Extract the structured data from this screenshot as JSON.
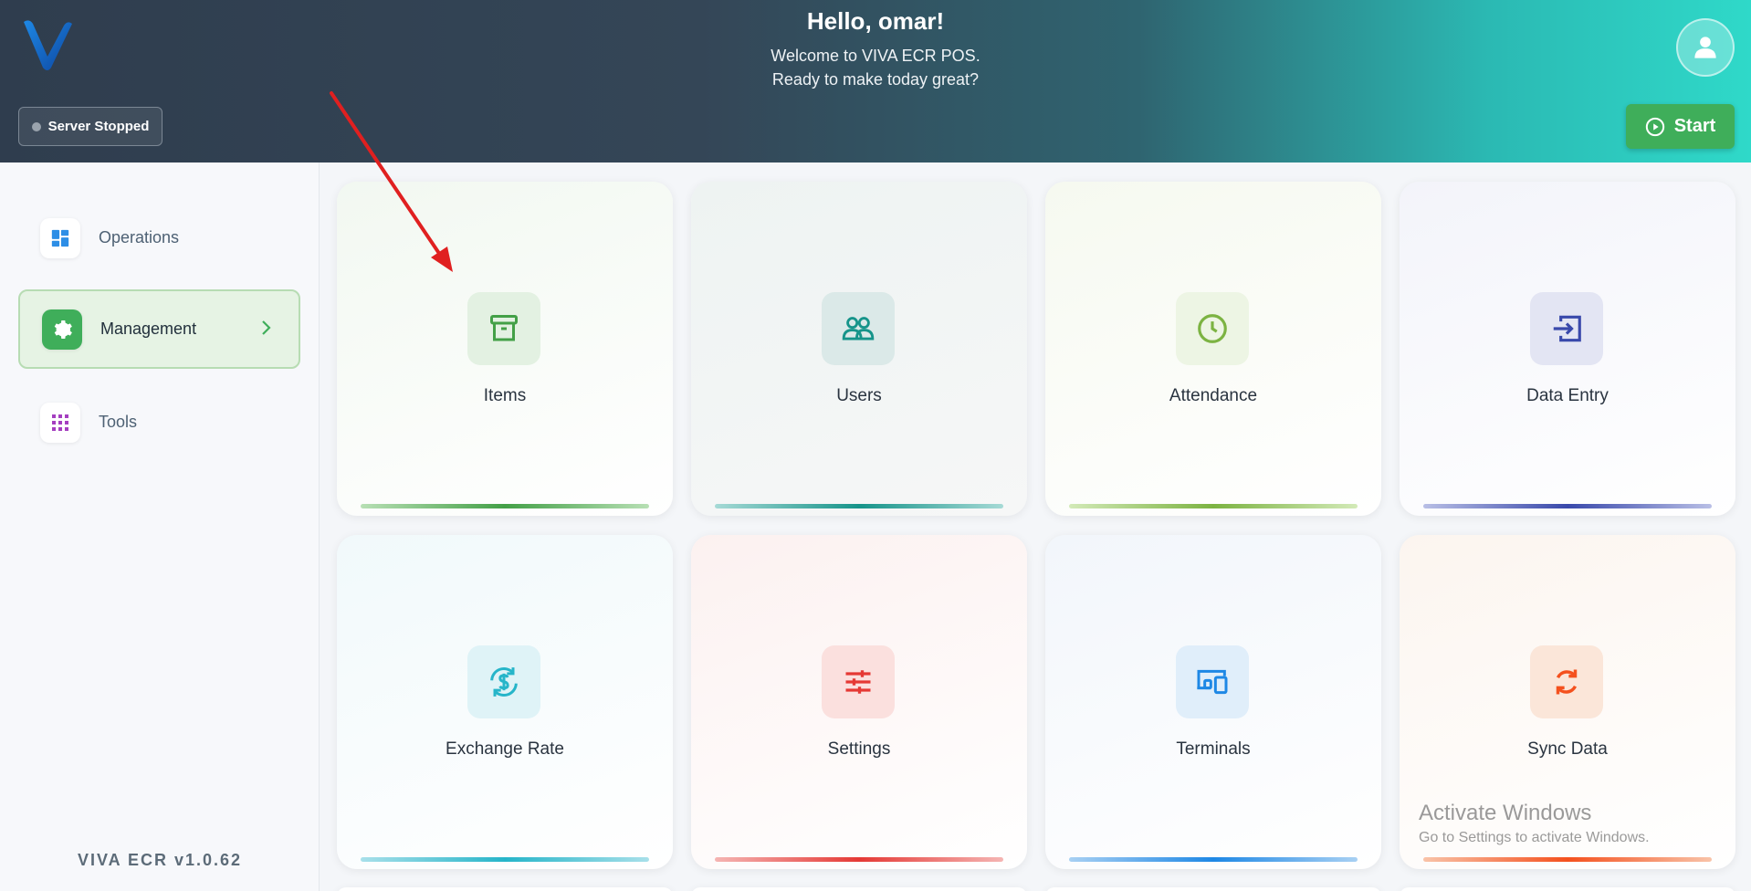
{
  "header": {
    "greeting": "Hello, omar!",
    "welcome": "Welcome to VIVA ECR POS.",
    "tagline": "Ready to make today great?",
    "server_status": "Server Stopped",
    "start_label": "Start"
  },
  "sidebar": {
    "items": [
      {
        "label": "Operations",
        "icon": "dashboard-icon",
        "active": false
      },
      {
        "label": "Management",
        "icon": "gear-icon",
        "active": true
      },
      {
        "label": "Tools",
        "icon": "grid-icon",
        "active": false
      }
    ],
    "version": "VIVA ECR  v1.0.62"
  },
  "cards": [
    {
      "label": "Items",
      "icon": "archive-box-icon",
      "color": "#43a047"
    },
    {
      "label": "Users",
      "icon": "users-icon",
      "color": "#16948a"
    },
    {
      "label": "Attendance",
      "icon": "clock-icon",
      "color": "#7cb342"
    },
    {
      "label": "Data Entry",
      "icon": "login-arrow-icon",
      "color": "#3949ab"
    },
    {
      "label": "Exchange Rate",
      "icon": "currency-exchange-icon",
      "color": "#26b5c9"
    },
    {
      "label": "Settings",
      "icon": "sliders-icon",
      "color": "#e53935"
    },
    {
      "label": "Terminals",
      "icon": "devices-icon",
      "color": "#1e88e5"
    },
    {
      "label": "Sync Data",
      "icon": "sync-icon",
      "color": "#f4511e"
    }
  ],
  "watermark": {
    "title": "Activate Windows",
    "subtitle": "Go to Settings to activate Windows."
  },
  "colors": {
    "accent_green": "#3fae5a",
    "header_dark": "#2f3d4e",
    "header_teal": "#2fd9c9"
  }
}
